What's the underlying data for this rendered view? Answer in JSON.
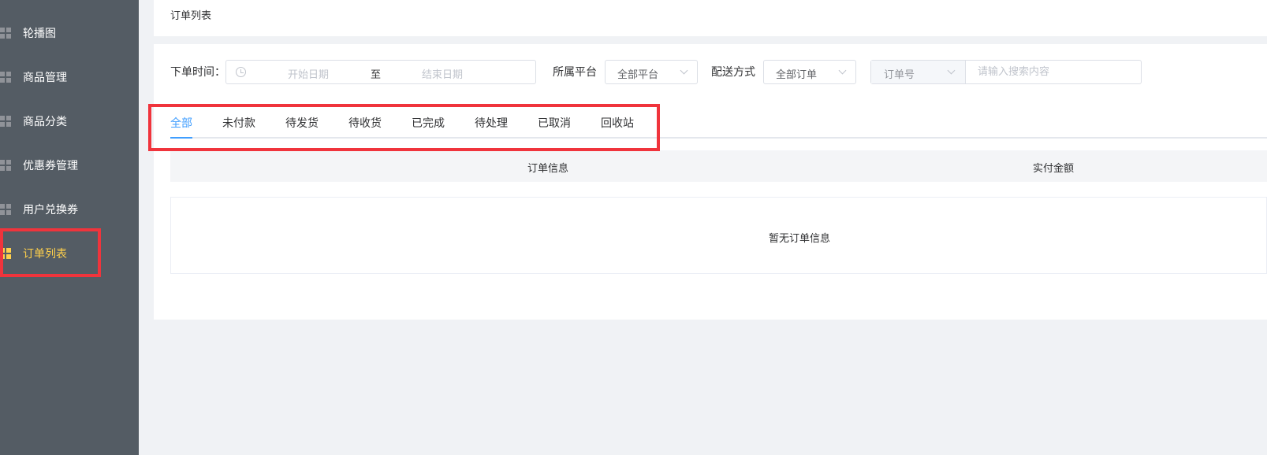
{
  "sidebar": {
    "items": [
      {
        "label": "轮播图",
        "active": false
      },
      {
        "label": "商品管理",
        "active": false
      },
      {
        "label": "商品分类",
        "active": false
      },
      {
        "label": "优惠券管理",
        "active": false
      },
      {
        "label": "用户兑换券",
        "active": false
      },
      {
        "label": "订单列表",
        "active": true
      }
    ]
  },
  "breadcrumb": {
    "current": "订单列表"
  },
  "filters": {
    "order_time_label": "下单时间：",
    "start_placeholder": "开始日期",
    "range_separator": "至",
    "end_placeholder": "结束日期",
    "platform_label": "所属平台",
    "platform_value": "全部平台",
    "delivery_label": "配送方式",
    "delivery_value": "全部订单",
    "search_field_value": "订单号",
    "search_placeholder": "请输入搜索内容"
  },
  "tabs": [
    {
      "label": "全部",
      "active": true
    },
    {
      "label": "未付款",
      "active": false
    },
    {
      "label": "待发货",
      "active": false
    },
    {
      "label": "待收货",
      "active": false
    },
    {
      "label": "已完成",
      "active": false
    },
    {
      "label": "待处理",
      "active": false
    },
    {
      "label": "已取消",
      "active": false
    },
    {
      "label": "回收站",
      "active": false
    }
  ],
  "table": {
    "columns": [
      "订单信息",
      "实付金额"
    ],
    "empty_text": "暂无订单信息"
  },
  "colors": {
    "sidebar_bg": "#545c64",
    "active_menu": "#ffd04b",
    "active_tab": "#409eff",
    "highlight": "#f0343c"
  },
  "icons": {
    "menu": "grid-icon",
    "date": "clock-icon",
    "select": "chevron-down-icon"
  }
}
